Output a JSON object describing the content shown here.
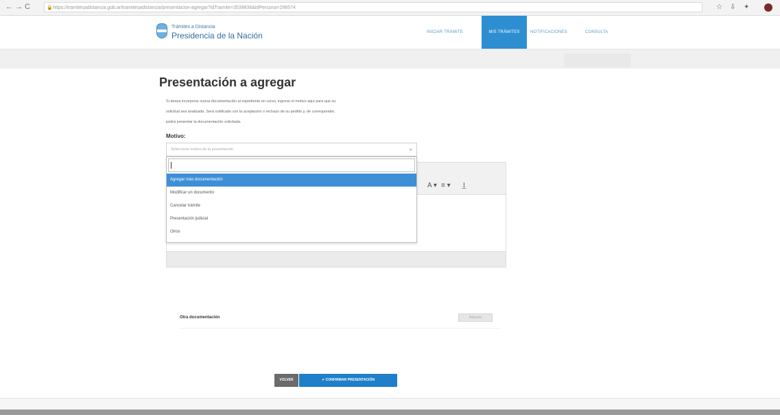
{
  "browser": {
    "url": "https://tramitesadistancia.gob.ar/tramitesadistancia/presentacion-agregar?idTramite=3539836&idPersona=296574",
    "back_glyph": "←",
    "forward_glyph": "→",
    "reload_glyph": "C",
    "lock_glyph": "🔒",
    "ext1": "☆",
    "ext2": "⇩",
    "ext3": "✦"
  },
  "header": {
    "logo_top": "Trámites a Distancia",
    "logo_main": "Presidencia de la Nación",
    "nav": [
      {
        "label": "INICIAR TRÁMITE",
        "active": false
      },
      {
        "label": "MIS TRÁMITES",
        "active": true
      },
      {
        "label": "NOTIFICACIONES",
        "active": false
      },
      {
        "label": "CONSULTA",
        "active": false
      }
    ]
  },
  "main": {
    "title": "Presentación a agregar",
    "intro_lines": [
      "Si desea incorporar nueva documentación al expediente en curso, ingrese el motivo aquí para que su",
      "solicitud sea analizada. Será notificado con la aceptación o rechazo de su pedido y, de corresponder,",
      "podrá presentar la documentación solicitada."
    ],
    "motivo_label": "Motivo:",
    "select_placeholder": "Seleccione motivo de la presentación",
    "select_clear": "×",
    "dropdown_search_value": "",
    "options": [
      {
        "label": "Agregar más documentación",
        "highlighted": true
      },
      {
        "label": "Modificar un documento",
        "highlighted": false
      },
      {
        "label": "Cancelar trámite",
        "highlighted": false
      },
      {
        "label": "Presentación judicial",
        "highlighted": false
      },
      {
        "label": "Otros",
        "highlighted": false
      }
    ],
    "editor_toolbar": {
      "font_color": "A ▾",
      "align": "≡ ▾",
      "clear_format": "I̲"
    },
    "doc_label": "Otra documentación",
    "doc_button": "Adjuntar",
    "back_button": "VOLVER",
    "confirm_button": "✔ CONFIRMAR PRESENTACIÓN"
  }
}
